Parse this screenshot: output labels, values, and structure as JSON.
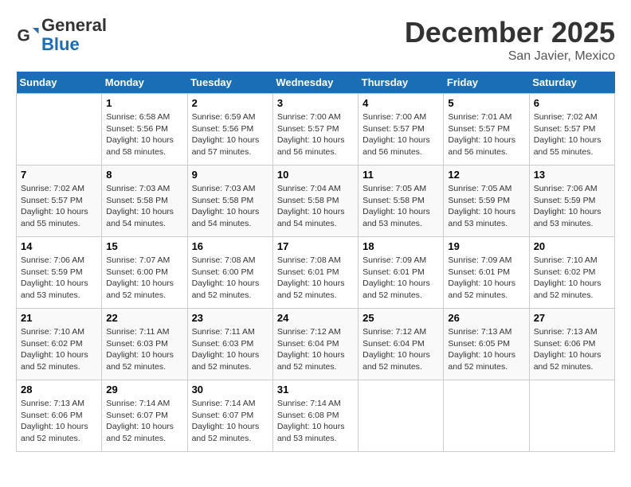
{
  "header": {
    "logo_line1": "General",
    "logo_line2": "Blue",
    "month": "December 2025",
    "location": "San Javier, Mexico"
  },
  "days_of_week": [
    "Sunday",
    "Monday",
    "Tuesday",
    "Wednesday",
    "Thursday",
    "Friday",
    "Saturday"
  ],
  "weeks": [
    [
      {
        "day": "",
        "empty": true
      },
      {
        "day": "1",
        "sunrise": "6:58 AM",
        "sunset": "5:56 PM",
        "daylight": "10 hours and 58 minutes."
      },
      {
        "day": "2",
        "sunrise": "6:59 AM",
        "sunset": "5:56 PM",
        "daylight": "10 hours and 57 minutes."
      },
      {
        "day": "3",
        "sunrise": "7:00 AM",
        "sunset": "5:57 PM",
        "daylight": "10 hours and 56 minutes."
      },
      {
        "day": "4",
        "sunrise": "7:00 AM",
        "sunset": "5:57 PM",
        "daylight": "10 hours and 56 minutes."
      },
      {
        "day": "5",
        "sunrise": "7:01 AM",
        "sunset": "5:57 PM",
        "daylight": "10 hours and 56 minutes."
      },
      {
        "day": "6",
        "sunrise": "7:02 AM",
        "sunset": "5:57 PM",
        "daylight": "10 hours and 55 minutes."
      }
    ],
    [
      {
        "day": "7",
        "sunrise": "7:02 AM",
        "sunset": "5:57 PM",
        "daylight": "10 hours and 55 minutes."
      },
      {
        "day": "8",
        "sunrise": "7:03 AM",
        "sunset": "5:58 PM",
        "daylight": "10 hours and 54 minutes."
      },
      {
        "day": "9",
        "sunrise": "7:03 AM",
        "sunset": "5:58 PM",
        "daylight": "10 hours and 54 minutes."
      },
      {
        "day": "10",
        "sunrise": "7:04 AM",
        "sunset": "5:58 PM",
        "daylight": "10 hours and 54 minutes."
      },
      {
        "day": "11",
        "sunrise": "7:05 AM",
        "sunset": "5:58 PM",
        "daylight": "10 hours and 53 minutes."
      },
      {
        "day": "12",
        "sunrise": "7:05 AM",
        "sunset": "5:59 PM",
        "daylight": "10 hours and 53 minutes."
      },
      {
        "day": "13",
        "sunrise": "7:06 AM",
        "sunset": "5:59 PM",
        "daylight": "10 hours and 53 minutes."
      }
    ],
    [
      {
        "day": "14",
        "sunrise": "7:06 AM",
        "sunset": "5:59 PM",
        "daylight": "10 hours and 53 minutes."
      },
      {
        "day": "15",
        "sunrise": "7:07 AM",
        "sunset": "6:00 PM",
        "daylight": "10 hours and 52 minutes."
      },
      {
        "day": "16",
        "sunrise": "7:08 AM",
        "sunset": "6:00 PM",
        "daylight": "10 hours and 52 minutes."
      },
      {
        "day": "17",
        "sunrise": "7:08 AM",
        "sunset": "6:01 PM",
        "daylight": "10 hours and 52 minutes."
      },
      {
        "day": "18",
        "sunrise": "7:09 AM",
        "sunset": "6:01 PM",
        "daylight": "10 hours and 52 minutes."
      },
      {
        "day": "19",
        "sunrise": "7:09 AM",
        "sunset": "6:01 PM",
        "daylight": "10 hours and 52 minutes."
      },
      {
        "day": "20",
        "sunrise": "7:10 AM",
        "sunset": "6:02 PM",
        "daylight": "10 hours and 52 minutes."
      }
    ],
    [
      {
        "day": "21",
        "sunrise": "7:10 AM",
        "sunset": "6:02 PM",
        "daylight": "10 hours and 52 minutes."
      },
      {
        "day": "22",
        "sunrise": "7:11 AM",
        "sunset": "6:03 PM",
        "daylight": "10 hours and 52 minutes."
      },
      {
        "day": "23",
        "sunrise": "7:11 AM",
        "sunset": "6:03 PM",
        "daylight": "10 hours and 52 minutes."
      },
      {
        "day": "24",
        "sunrise": "7:12 AM",
        "sunset": "6:04 PM",
        "daylight": "10 hours and 52 minutes."
      },
      {
        "day": "25",
        "sunrise": "7:12 AM",
        "sunset": "6:04 PM",
        "daylight": "10 hours and 52 minutes."
      },
      {
        "day": "26",
        "sunrise": "7:13 AM",
        "sunset": "6:05 PM",
        "daylight": "10 hours and 52 minutes."
      },
      {
        "day": "27",
        "sunrise": "7:13 AM",
        "sunset": "6:06 PM",
        "daylight": "10 hours and 52 minutes."
      }
    ],
    [
      {
        "day": "28",
        "sunrise": "7:13 AM",
        "sunset": "6:06 PM",
        "daylight": "10 hours and 52 minutes."
      },
      {
        "day": "29",
        "sunrise": "7:14 AM",
        "sunset": "6:07 PM",
        "daylight": "10 hours and 52 minutes."
      },
      {
        "day": "30",
        "sunrise": "7:14 AM",
        "sunset": "6:07 PM",
        "daylight": "10 hours and 52 minutes."
      },
      {
        "day": "31",
        "sunrise": "7:14 AM",
        "sunset": "6:08 PM",
        "daylight": "10 hours and 53 minutes."
      },
      {
        "day": "",
        "empty": true
      },
      {
        "day": "",
        "empty": true
      },
      {
        "day": "",
        "empty": true
      }
    ]
  ]
}
